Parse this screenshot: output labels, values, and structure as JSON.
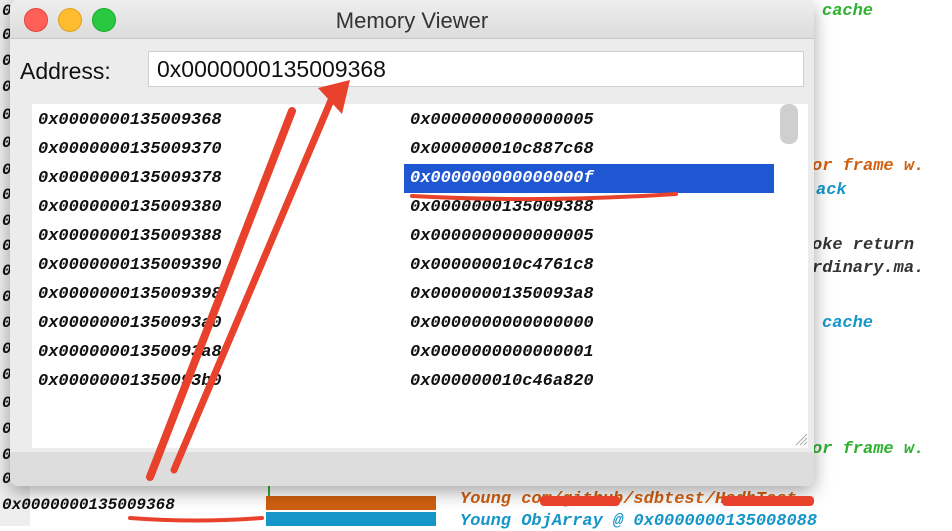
{
  "window": {
    "title": "Memory Viewer",
    "address_label": "Address:",
    "address_value": "0x0000000135009368"
  },
  "memory_rows": [
    {
      "address": "0x0000000135009368",
      "value": "0x0000000000000005",
      "selected": false
    },
    {
      "address": "0x0000000135009370",
      "value": "0x000000010c887c68",
      "selected": false
    },
    {
      "address": "0x0000000135009378",
      "value": "0x000000000000000f",
      "selected": true
    },
    {
      "address": "0x0000000135009380",
      "value": "0x0000000135009388",
      "selected": false
    },
    {
      "address": "0x0000000135009388",
      "value": "0x0000000000000005",
      "selected": false
    },
    {
      "address": "0x0000000135009390",
      "value": "0x000000010c4761c8",
      "selected": false
    },
    {
      "address": "0x0000000135009398",
      "value": "0x00000001350093a8",
      "selected": false
    },
    {
      "address": "0x00000001350093a0",
      "value": "0x0000000000000000",
      "selected": false
    },
    {
      "address": "0x00000001350093a8",
      "value": "0x0000000000000001",
      "selected": false
    },
    {
      "address": "0x00000001350093b0",
      "value": "0x000000010c46a820",
      "selected": false
    }
  ],
  "background": {
    "left_prefix": "0.",
    "left_prefix_letter": "0",
    "code_lines": {
      "cache_top": "cache",
      "frame_1": "or frame w.",
      "ack": "ack",
      "oke_return": "oke return",
      "rdinary": "rdinary.ma.",
      "cache_mid": "cache",
      "frame_2": "or frame w."
    },
    "bottom_address": "0x0000000135009368",
    "bottom_line1": "Young com/github/sdbtest/HsdbTest",
    "bottom_line2": "Young ObjArray @ 0x0000000135008088"
  },
  "colors": {
    "selection": "#1f56d2",
    "annotation": "#e8412c",
    "green_text": "#2fb12f",
    "orange_text": "#d05f10",
    "blue_text": "#1596c8"
  }
}
